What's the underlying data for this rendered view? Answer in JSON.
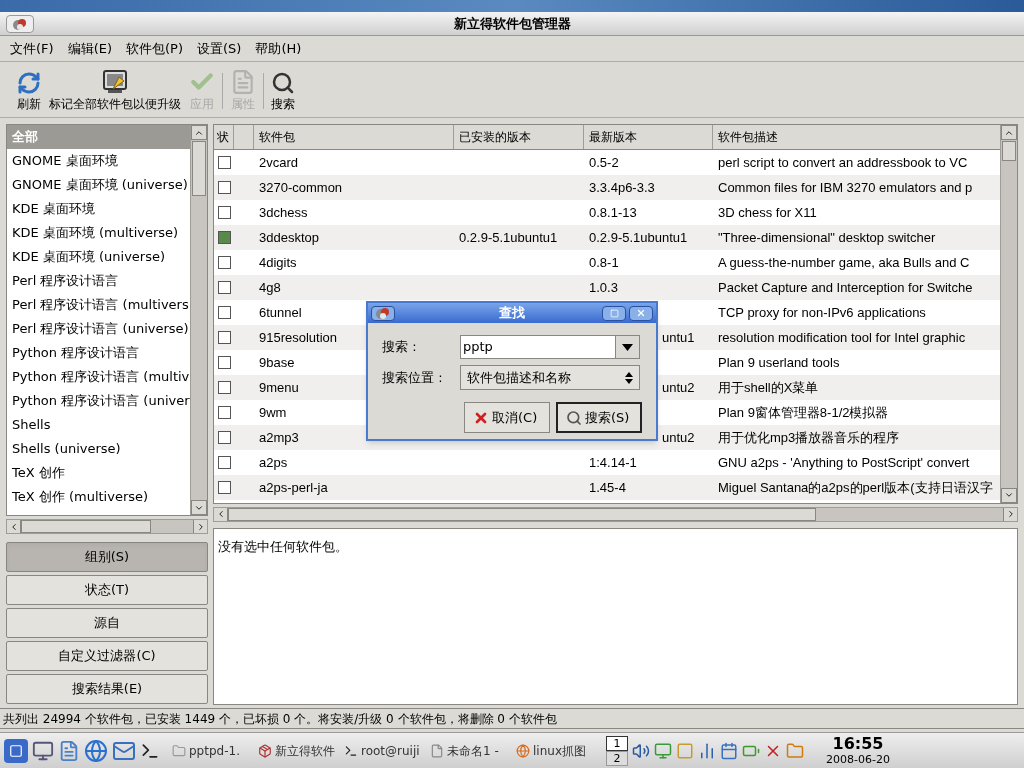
{
  "window": {
    "title": "新立得软件包管理器"
  },
  "menu": [
    "文件(F)",
    "编辑(E)",
    "软件包(P)",
    "设置(S)",
    "帮助(H)"
  ],
  "toolbar": [
    {
      "kind": "refresh",
      "label": "刷新",
      "disabled": false
    },
    {
      "kind": "upgrade",
      "label": "标记全部软件包以便升级",
      "disabled": false
    },
    {
      "kind": "apply",
      "label": "应用",
      "disabled": true
    },
    {
      "kind": "separator"
    },
    {
      "kind": "properties",
      "label": "属性",
      "disabled": true
    },
    {
      "kind": "separator"
    },
    {
      "kind": "search",
      "label": "搜索",
      "disabled": false
    }
  ],
  "sidebar": {
    "items": [
      {
        "label": "全部",
        "selected": true
      },
      {
        "label": "GNOME 桌面环境",
        "selected": false
      },
      {
        "label": "GNOME 桌面环境 (universe)",
        "selected": false
      },
      {
        "label": "KDE 桌面环境",
        "selected": false
      },
      {
        "label": "KDE 桌面环境 (multiverse)",
        "selected": false
      },
      {
        "label": "KDE 桌面环境 (universe)",
        "selected": false
      },
      {
        "label": "Perl 程序设计语言",
        "selected": false
      },
      {
        "label": "Perl 程序设计语言 (multivers",
        "selected": false
      },
      {
        "label": "Perl 程序设计语言 (universe)",
        "selected": false
      },
      {
        "label": "Python 程序设计语言",
        "selected": false
      },
      {
        "label": "Python 程序设计语言 (multiv",
        "selected": false
      },
      {
        "label": "Python 程序设计语言 (univer",
        "selected": false
      },
      {
        "label": "Shells",
        "selected": false
      },
      {
        "label": "Shells (universe)",
        "selected": false
      },
      {
        "label": "TeX 创作",
        "selected": false
      },
      {
        "label": "TeX 创作 (multiverse)",
        "selected": false
      }
    ],
    "buttons": [
      {
        "label": "组别(S)",
        "selected": true
      },
      {
        "label": "状态(T)",
        "selected": false
      },
      {
        "label": "源自",
        "selected": false
      },
      {
        "label": "自定义过滤器(C)",
        "selected": false
      },
      {
        "label": "搜索结果(E)",
        "selected": false
      }
    ]
  },
  "table": {
    "columns": [
      "状",
      "软件包",
      "已安装的版本",
      "最新版本",
      "软件包描述"
    ],
    "rows": [
      {
        "installed": false,
        "name": "2vcard",
        "latest_version": "0.5-2",
        "description": "perl script to convert an addressbook to VC"
      },
      {
        "installed": false,
        "name": "3270-common",
        "latest_version": "3.3.4p6-3.3",
        "description": "Common files for IBM 3270 emulators and p"
      },
      {
        "installed": false,
        "name": "3dchess",
        "latest_version": "0.8.1-13",
        "description": "3D chess for X11"
      },
      {
        "installed": true,
        "name": "3ddesktop",
        "installed_version": "0.2.9-5.1ubuntu1",
        "latest_version": "0.2.9-5.1ubuntu1",
        "description": "\"Three-dimensional\" desktop switcher"
      },
      {
        "installed": false,
        "name": "4digits",
        "latest_version": "0.8-1",
        "description": "A guess-the-number game, aka Bulls and C"
      },
      {
        "installed": false,
        "name": "4g8",
        "latest_version": "1.0.3",
        "description": "Packet Capture and Interception for Switche"
      },
      {
        "installed": false,
        "name": "6tunnel",
        "description": "TCP proxy for non-IPv6 applications"
      },
      {
        "installed": false,
        "name": "915resolution",
        "latest_version": "untu1",
        "latest_cut": true,
        "description": "resolution modification tool for Intel graphic"
      },
      {
        "installed": false,
        "name": "9base",
        "description": "Plan 9 userland tools"
      },
      {
        "installed": false,
        "name": "9menu",
        "latest_version": "untu2",
        "latest_cut": true,
        "description": "用于shell的X菜单"
      },
      {
        "installed": false,
        "name": "9wm",
        "description": "Plan 9窗体管理器8-1/2模拟器"
      },
      {
        "installed": false,
        "name": "a2mp3",
        "latest_version": "untu2",
        "latest_cut": true,
        "description": "用于优化mp3播放器音乐的程序"
      },
      {
        "installed": false,
        "name": "a2ps",
        "latest_version": "1:4.14-1",
        "description": "GNU a2ps - 'Anything to PostScript' convert"
      },
      {
        "installed": false,
        "name": "a2ps-perl-ja",
        "latest_version": "1.45-4",
        "description": "Miguel Santana的a2ps的perl版本(支持日语汉字"
      }
    ]
  },
  "details": {
    "text": "没有选中任何软件包。"
  },
  "dialog": {
    "title": "查找",
    "search_label": "搜索 :",
    "search_value": "pptp",
    "scope_label": "搜索位置 :",
    "scope_value": "软件包描述和名称",
    "buttons": [
      {
        "kind": "cancel",
        "label": "取消(C)",
        "default": false
      },
      {
        "kind": "search",
        "label": "搜索(S)",
        "default": true
      }
    ]
  },
  "status_bar": "共列出 24994 个软件包，已安装 1449 个，已坏损 0 个。将安装/升级 0 个软件包，将删除 0 个软件包",
  "taskbar": {
    "tasks": [
      {
        "label": "pptpd-1.",
        "kind": "folder"
      },
      {
        "label": "新立得软件",
        "kind": "package"
      },
      {
        "label": "root@ruiji",
        "kind": "terminal"
      },
      {
        "label": "未命名1 -",
        "kind": "document"
      },
      {
        "label": "linux抓图",
        "kind": "browser"
      }
    ],
    "pager": [
      {
        "label": "1",
        "selected": true
      },
      {
        "label": "2",
        "selected": false
      }
    ],
    "clock": {
      "time": "16:55",
      "date": "2008-06-20"
    }
  }
}
